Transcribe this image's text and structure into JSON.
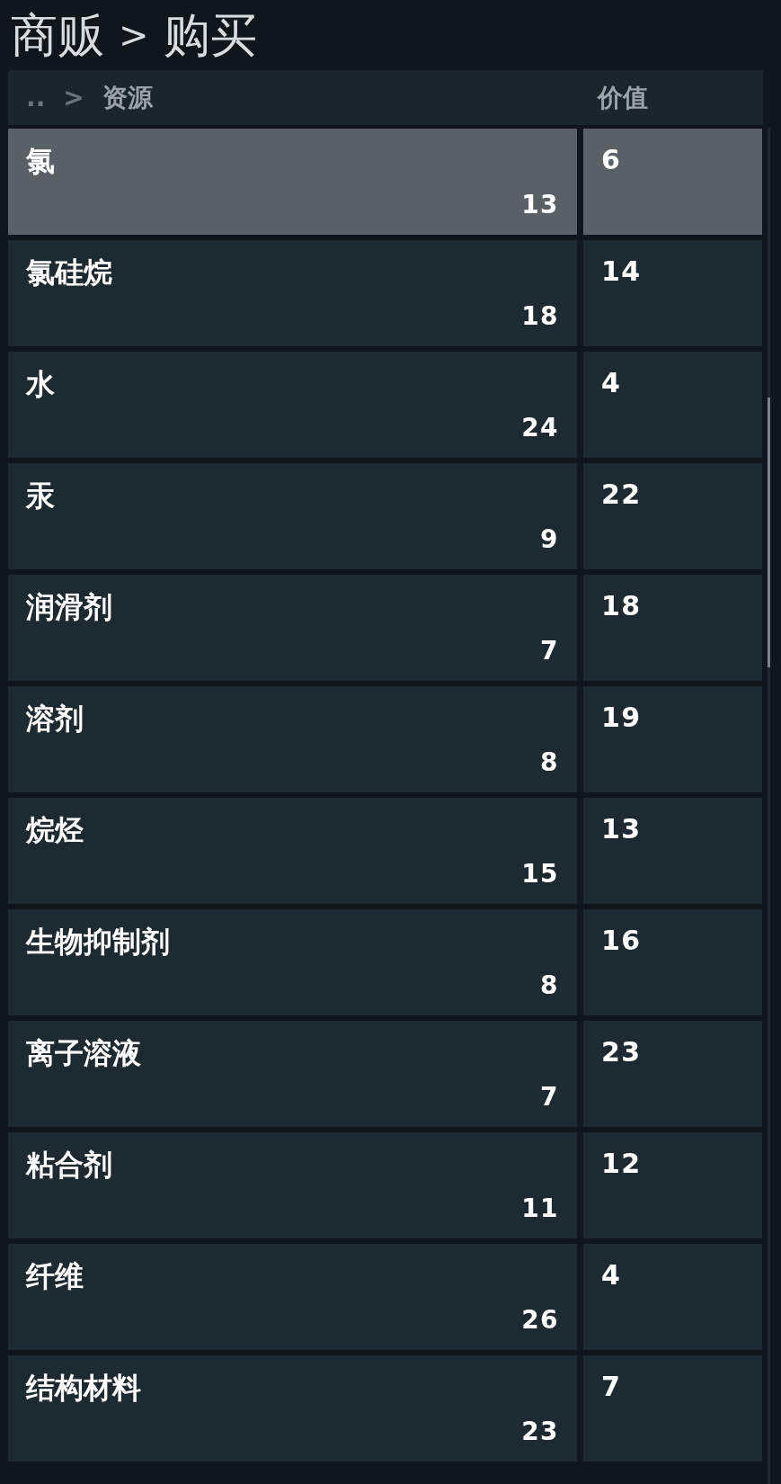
{
  "title": {
    "parent": "商贩",
    "separator": ">",
    "current": "购买"
  },
  "header": {
    "up": "..",
    "separator": ">",
    "column_1": "资源",
    "column_2": "价值"
  },
  "rows": [
    {
      "name": "氯",
      "quantity": "13",
      "value": "6",
      "selected": true
    },
    {
      "name": "氯硅烷",
      "quantity": "18",
      "value": "14",
      "selected": false
    },
    {
      "name": "水",
      "quantity": "24",
      "value": "4",
      "selected": false
    },
    {
      "name": "汞",
      "quantity": "9",
      "value": "22",
      "selected": false
    },
    {
      "name": "润滑剂",
      "quantity": "7",
      "value": "18",
      "selected": false
    },
    {
      "name": "溶剂",
      "quantity": "8",
      "value": "19",
      "selected": false
    },
    {
      "name": "烷烃",
      "quantity": "15",
      "value": "13",
      "selected": false
    },
    {
      "name": "生物抑制剂",
      "quantity": "8",
      "value": "16",
      "selected": false
    },
    {
      "name": "离子溶液",
      "quantity": "7",
      "value": "23",
      "selected": false
    },
    {
      "name": "粘合剂",
      "quantity": "11",
      "value": "12",
      "selected": false
    },
    {
      "name": "纤维",
      "quantity": "26",
      "value": "4",
      "selected": false
    },
    {
      "name": "结构材料",
      "quantity": "23",
      "value": "7",
      "selected": false
    }
  ]
}
